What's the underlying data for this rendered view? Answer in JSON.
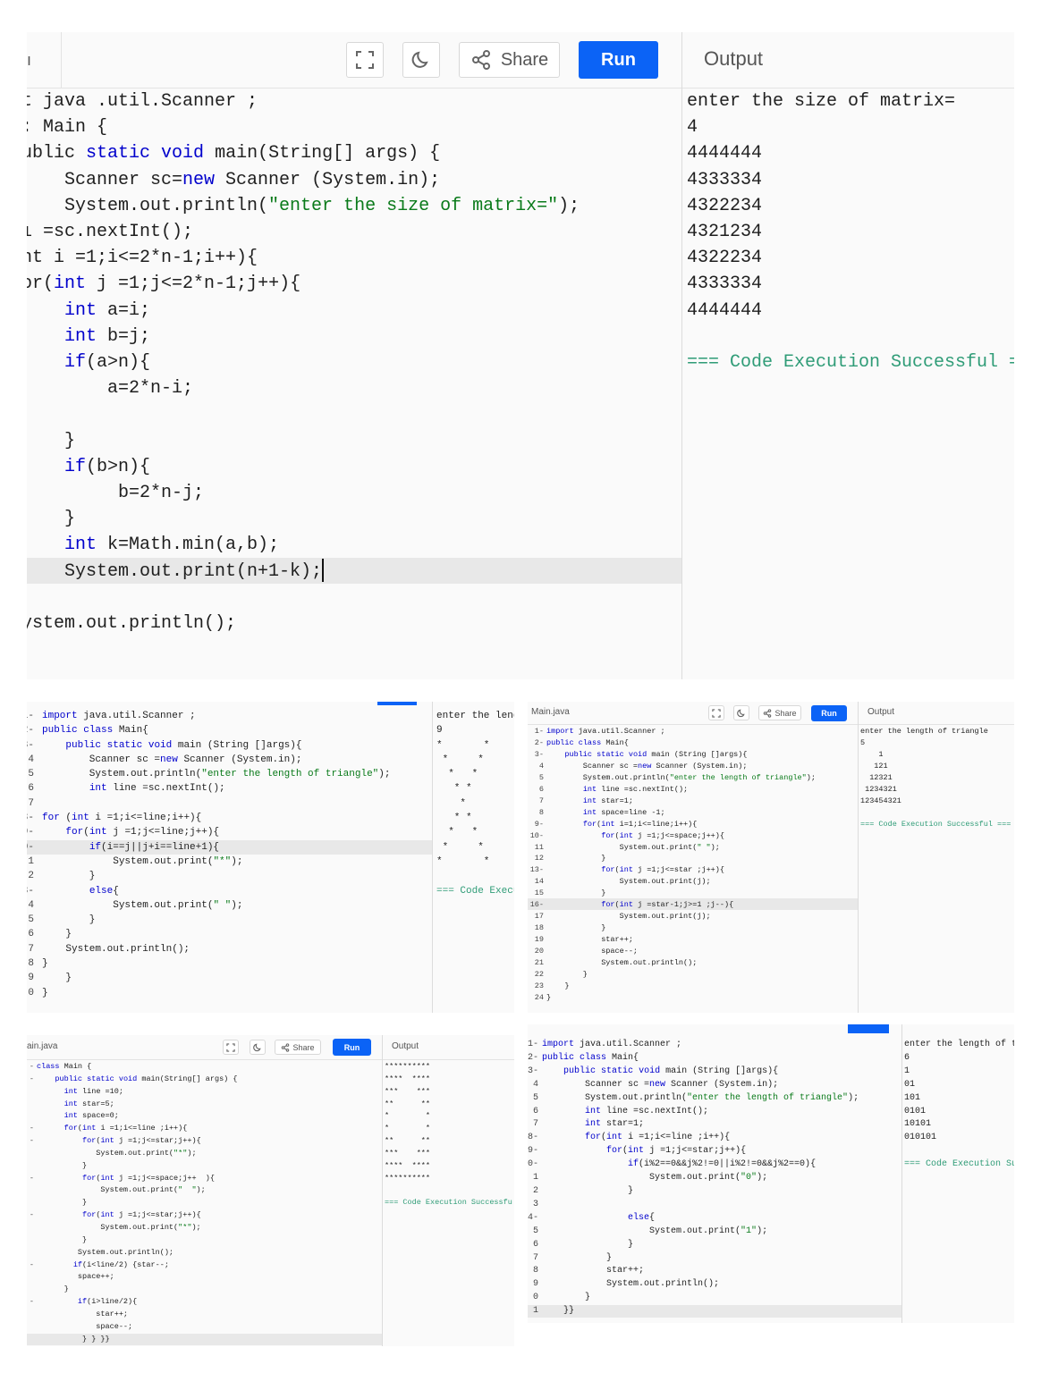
{
  "editor": {
    "toolbar": {
      "share_label": "Share",
      "run_label": "Run",
      "output_label": "Output",
      "tab_fragment": "ı"
    },
    "p1": {
      "code": [
        "t java .util.Scanner ;",
        ": Main {",
        "ublic static void main(String[] args) {",
        "    Scanner sc=new Scanner (System.in);",
        "    System.out.println(\"enter the size of matrix=\");",
        "ı =sc.nextInt();",
        "nt i =1;i<=2*n-1;i++){",
        "or(int j =1;j<=2*n-1;j++){",
        "    int a=i;",
        "    int b=j;",
        "    if(a>n){",
        "        a=2*n-i;",
        "",
        "    }",
        "    if(b>n){",
        "         b=2*n-j;",
        "    }",
        "    int k=Math.min(a,b);",
        "    System.out.print(n+1-k);",
        "",
        "ystem.out.println();"
      ],
      "output": [
        "enter the size of matrix=",
        "4",
        "4444444",
        "4333334",
        "4322234",
        "4321234",
        "4322234",
        "4333334",
        "4444444",
        "",
        "=== Code Execution Successful ==="
      ]
    },
    "p2": {
      "gutter": [
        "1-",
        "2-",
        "3-",
        "4",
        "5",
        "6",
        "7",
        "8-",
        "9-",
        "0-",
        "1",
        "2",
        "3-",
        "4",
        "5",
        "6",
        "7",
        "8",
        "9",
        "0"
      ],
      "code": [
        "import java.util.Scanner ;",
        "public class Main{",
        "    public static void main (String []args){",
        "        Scanner sc =new Scanner (System.in);",
        "        System.out.println(\"enter the length of triangle\");",
        "        int line =sc.nextInt();",
        "",
        "for (int i =1;i<=line;i++){",
        "    for(int j =1;j<=line;j++){",
        "        if(i==j||j+i==line+1){",
        "            System.out.print(\"*\");",
        "        }",
        "        else{",
        "            System.out.print(\" \");",
        "        }",
        "    }",
        "    System.out.println();",
        "}",
        "    }",
        "}"
      ],
      "output": [
        "enter the leng",
        "9",
        "*       *",
        " *     *",
        "  *   *",
        "   * *",
        "    *",
        "   * *",
        "  *   *",
        " *     *",
        "*       *",
        "",
        "=== Code Execu"
      ]
    },
    "p3": {
      "tab_label": "Main.java",
      "share_label": "Share",
      "run_label": "Run",
      "output_label": "Output",
      "gutter": [
        "1-",
        "2-",
        "3-",
        "4",
        "5",
        "6",
        "7",
        "8",
        "9-",
        "10-",
        "11",
        "12",
        "13-",
        "14",
        "15",
        "16-",
        "17",
        "18",
        "19",
        "20",
        "21",
        "22",
        "23",
        "24"
      ],
      "code": [
        "import java.util.Scanner ;",
        "public class Main{",
        "    public static void main (String []args){",
        "        Scanner sc =new Scanner (System.in);",
        "        System.out.println(\"enter the length of triangle\");",
        "        int line =sc.nextInt();",
        "        int star=1;",
        "        int space=line -1;",
        "        for(int i=1;i<=line;i++){",
        "            for(int j =1;j<=space;j++){",
        "                System.out.print(\" \");",
        "            }",
        "            for(int j =1;j<=star ;j++){",
        "                System.out.print(j);",
        "            }",
        "            for(int j =star-1;j>=1 ;j--){",
        "                System.out.print(j);",
        "            }",
        "            star++;",
        "            space--;",
        "            System.out.println();",
        "        }",
        "    }",
        "}"
      ],
      "output": [
        "enter the length of triangle",
        "5",
        "    1",
        "   121",
        "  12321",
        " 1234321",
        "123454321",
        "",
        "=== Code Execution Successful ==="
      ]
    },
    "p4": {
      "tab_label": "ain.java",
      "share_label": "Share",
      "run_label": "Run",
      "output_label": "Output",
      "gutter": [
        "-",
        "-",
        "",
        "",
        "",
        "-",
        "-",
        "",
        "",
        "-",
        "",
        "",
        "-",
        "",
        "",
        "",
        "-",
        "",
        "",
        "-",
        "",
        "",
        ""
      ],
      "code": [
        "class Main {",
        "    public static void main(String[] args) {",
        "      int line =10;",
        "      int star=5;",
        "      int space=0;",
        "      for(int i =1;i<=line ;i++){",
        "          for(int j =1;j<=star;j++){",
        "             System.out.print(\"*\");",
        "          }",
        "          for(int j =1;j<=space;j++  ){",
        "              System.out.print(\"  \");",
        "          }",
        "          for(int j =1;j<=star;j++){",
        "              System.out.print(\"*\");",
        "          }",
        "         System.out.println();",
        "        if(i<line/2) {star--;",
        "         space++;",
        "      }",
        "         if(i>line/2){",
        "             star++;",
        "             space--;",
        "          } } }}"
      ],
      "output": [
        "**********",
        "****  ****",
        "***    ***",
        "**      **",
        "*        *",
        "*        *",
        "**      **",
        "***    ***",
        "****  ****",
        "**********",
        "",
        "=== Code Execution Successfu"
      ]
    },
    "p5": {
      "gutter": [
        "1-",
        "2-",
        "3-",
        "4",
        "5",
        "6",
        "7",
        "8-",
        "9-",
        "0-",
        "1",
        "2",
        "3",
        "4-",
        "5",
        "6",
        "7",
        "8",
        "9",
        "0",
        "1"
      ],
      "code": [
        "import java.util.Scanner ;",
        "public class Main{",
        "    public static void main (String []args){",
        "        Scanner sc =new Scanner (System.in);",
        "        System.out.println(\"enter the length of triangle\");",
        "        int line =sc.nextInt();",
        "        int star=1;",
        "        for(int i =1;i<=line ;i++){",
        "            for(int j =1;j<=star;j++){",
        "                if(i%2==0&&j%2!=0||i%2!=0&&j%2==0){",
        "                    System.out.print(\"0\");",
        "                }",
        "",
        "                else{",
        "                    System.out.print(\"1\");",
        "                }",
        "            }",
        "            star++;",
        "            System.out.println();",
        "        }",
        "    }}"
      ],
      "output": [
        "enter the length of tr",
        "6",
        "1",
        "01",
        "101",
        "0101",
        "10101",
        "010101",
        "",
        "=== Code Execution Suc"
      ]
    }
  }
}
